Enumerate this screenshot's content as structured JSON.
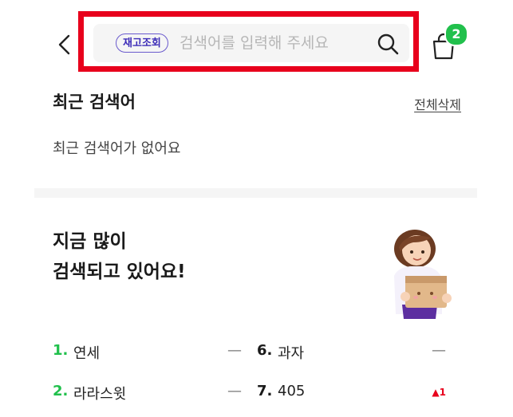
{
  "search": {
    "badge_label": "재고조회",
    "placeholder": "검색어를 입력해 주세요"
  },
  "cart": {
    "count": "2"
  },
  "recent": {
    "title": "최근 검색어",
    "delete_all_label": "전체삭제",
    "empty_message": "최근 검색어가 없어요"
  },
  "trending": {
    "title_line1": "지금 많이",
    "title_line2": "검색되고 있어요!",
    "items": [
      {
        "rank": "1.",
        "label": "연세",
        "change": "—"
      },
      {
        "rank": "2.",
        "label": "라라스윗",
        "change": "—"
      },
      {
        "rank": "6.",
        "label": "과자",
        "change": "—"
      },
      {
        "rank": "7.",
        "label": "405",
        "change": "▲1"
      }
    ]
  },
  "colors": {
    "accent_green": "#21c04c",
    "highlight_red": "#e8001c",
    "badge_purple": "#6a5acd"
  }
}
